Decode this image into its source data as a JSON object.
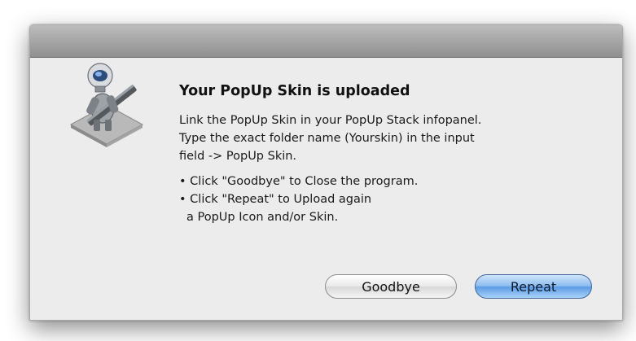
{
  "dialog": {
    "title": "Your PopUp Skin is uploaded",
    "message_lines": [
      "Link the PopUp Skin in your PopUp Stack infopanel.",
      "Type the exact folder name (Yourskin) in the input",
      "field -> PopUp Skin."
    ],
    "bullets": [
      "• Click \"Goodbye\" to Close the program.",
      "• Click \"Repeat\" to Upload again",
      "a PopUp Icon and/or Skin."
    ],
    "icon": "automator-robot-icon"
  },
  "buttons": {
    "goodbye_label": "Goodbye",
    "repeat_label": "Repeat"
  },
  "colors": {
    "default_button": "#5c9be4",
    "window_background": "#ececec"
  }
}
